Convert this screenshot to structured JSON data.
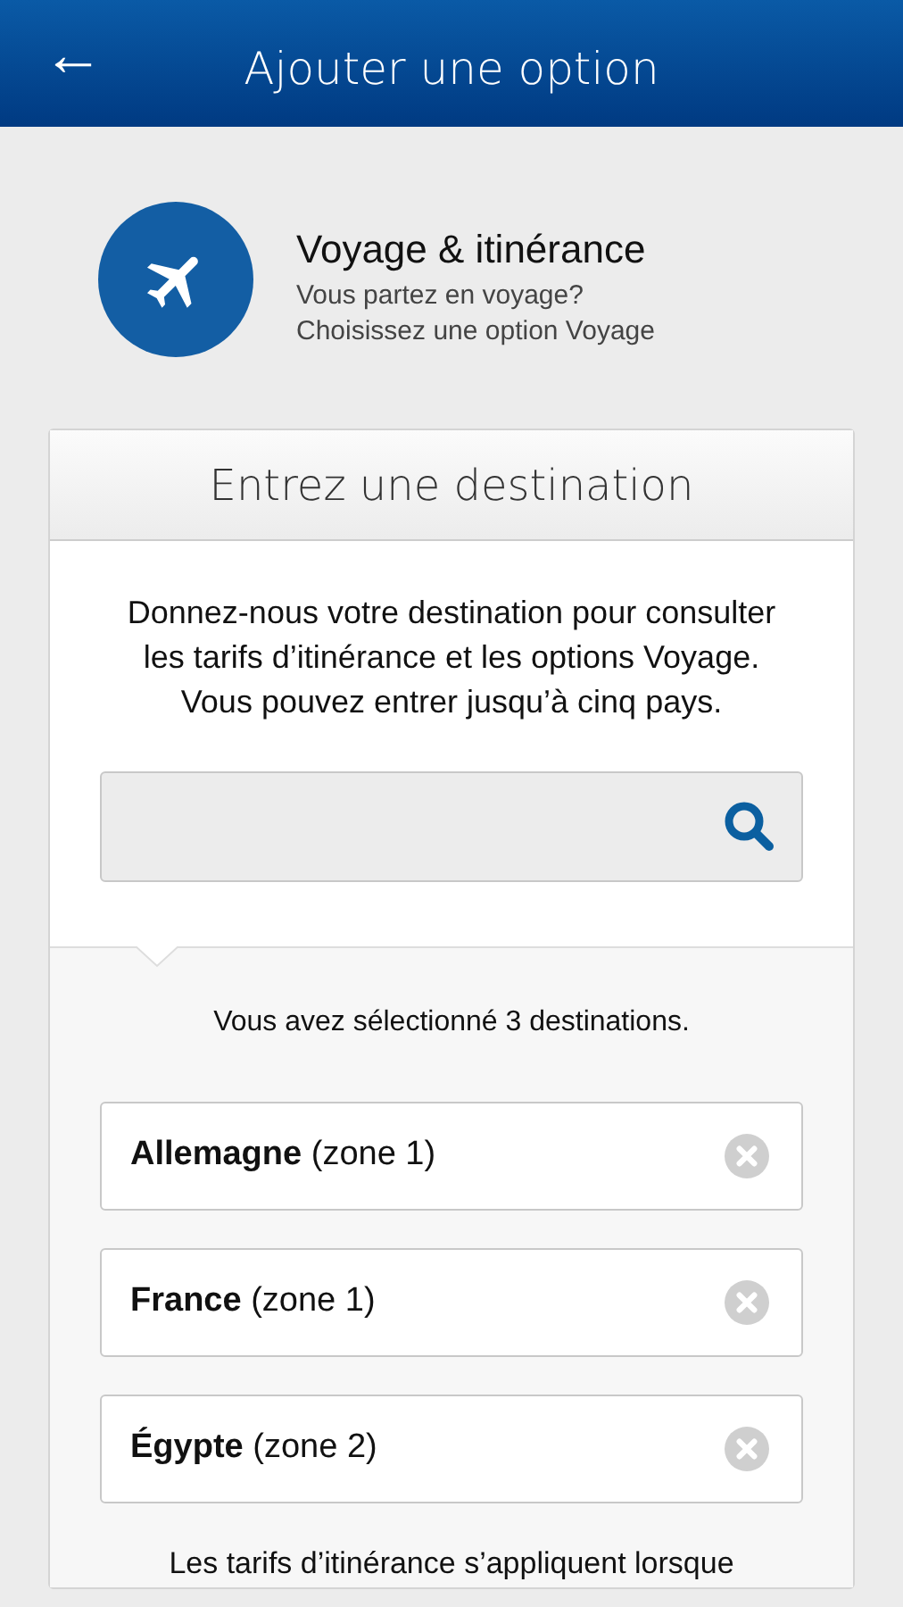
{
  "header": {
    "back": "←",
    "title": "Ajouter une option"
  },
  "hero": {
    "title": "Voyage & itinérance",
    "subtitle_lines": [
      "Vous partez en voyage?",
      "Choisissez une option Voyage"
    ]
  },
  "card": {
    "title": "Entrez une destination",
    "intro": "Donnez-nous votre destination pour consulter les tarifs d’itinérance et les options Voyage. Vous pouvez entrer jusqu’à cinq pays.",
    "selected_count": "Vous avez sélectionné 3 destinations.",
    "destinations": [
      {
        "label": "**Allemagne** (zone 1)"
      },
      {
        "label": "**France** (zone 1)"
      },
      {
        "label": "**Égypte** (zone 2)"
      }
    ],
    "footer_note": "Les tarifs d’itinérance s’appliquent lorsque"
  }
}
